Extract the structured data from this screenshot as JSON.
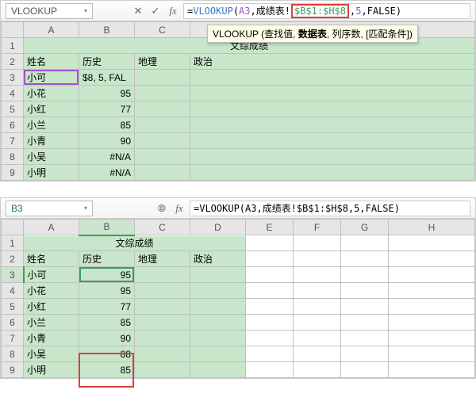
{
  "top": {
    "namebox": "VLOOKUP",
    "formula_parts": {
      "prefix": "=",
      "fn": "VLOOKUP",
      "open": "(",
      "arg1": "A3",
      "sep1": ", ",
      "arg2_pre": "成绩表",
      "arg2_bang": "!",
      "arg2_hl": "$B$1:$H$8",
      "sep2": ",",
      "arg3": "5",
      "sep3": ", ",
      "arg4": "FALSE",
      "close": ")"
    },
    "tooltip": {
      "fn": "VLOOKUP",
      "open": " (查找值, ",
      "bold": "数据表",
      "rest": ", 列序数, [匹配条件])"
    },
    "columns": [
      "A",
      "B",
      "C"
    ],
    "title": "文综成绩",
    "headers": [
      "姓名",
      "历史",
      "地理",
      "政治"
    ],
    "rows": [
      {
        "n": "3",
        "name": "小可",
        "hist": "$8, 5, FAL"
      },
      {
        "n": "4",
        "name": "小花",
        "hist": "95"
      },
      {
        "n": "5",
        "name": "小红",
        "hist": "77"
      },
      {
        "n": "6",
        "name": "小兰",
        "hist": "85"
      },
      {
        "n": "7",
        "name": "小青",
        "hist": "90"
      },
      {
        "n": "8",
        "name": "小吴",
        "hist": "#N/A"
      },
      {
        "n": "9",
        "name": "小明",
        "hist": "#N/A"
      }
    ],
    "chart_data": {
      "type": "table",
      "title": "文综成绩",
      "columns": [
        "姓名",
        "历史",
        "地理",
        "政治"
      ],
      "rows": [
        [
          "小可",
          null,
          null,
          null
        ],
        [
          "小花",
          95,
          null,
          null
        ],
        [
          "小红",
          77,
          null,
          null
        ],
        [
          "小兰",
          85,
          null,
          null
        ],
        [
          "小青",
          90,
          null,
          null
        ],
        [
          "小吴",
          "#N/A",
          null,
          null
        ],
        [
          "小明",
          "#N/A",
          null,
          null
        ]
      ]
    }
  },
  "bottom": {
    "namebox": "B3",
    "formula": "=VLOOKUP(A3,成绩表!$B$1:$H$8,5,FALSE)",
    "columns": [
      "A",
      "B",
      "C",
      "D",
      "E",
      "F",
      "G",
      "H"
    ],
    "title": "文综成绩",
    "headers": [
      "姓名",
      "历史",
      "地理",
      "政治"
    ],
    "rows": [
      {
        "n": "3",
        "name": "小可",
        "hist": "95"
      },
      {
        "n": "4",
        "name": "小花",
        "hist": "95"
      },
      {
        "n": "5",
        "name": "小红",
        "hist": "77"
      },
      {
        "n": "6",
        "name": "小兰",
        "hist": "85"
      },
      {
        "n": "7",
        "name": "小青",
        "hist": "90"
      },
      {
        "n": "8",
        "name": "小吴",
        "hist": "88"
      },
      {
        "n": "9",
        "name": "小明",
        "hist": "85"
      }
    ],
    "chart_data": {
      "type": "table",
      "title": "文综成绩",
      "columns": [
        "姓名",
        "历史",
        "地理",
        "政治"
      ],
      "rows": [
        [
          "小可",
          95,
          null,
          null
        ],
        [
          "小花",
          95,
          null,
          null
        ],
        [
          "小红",
          77,
          null,
          null
        ],
        [
          "小兰",
          85,
          null,
          null
        ],
        [
          "小青",
          90,
          null,
          null
        ],
        [
          "小吴",
          88,
          null,
          null
        ],
        [
          "小明",
          85,
          null,
          null
        ]
      ]
    }
  }
}
